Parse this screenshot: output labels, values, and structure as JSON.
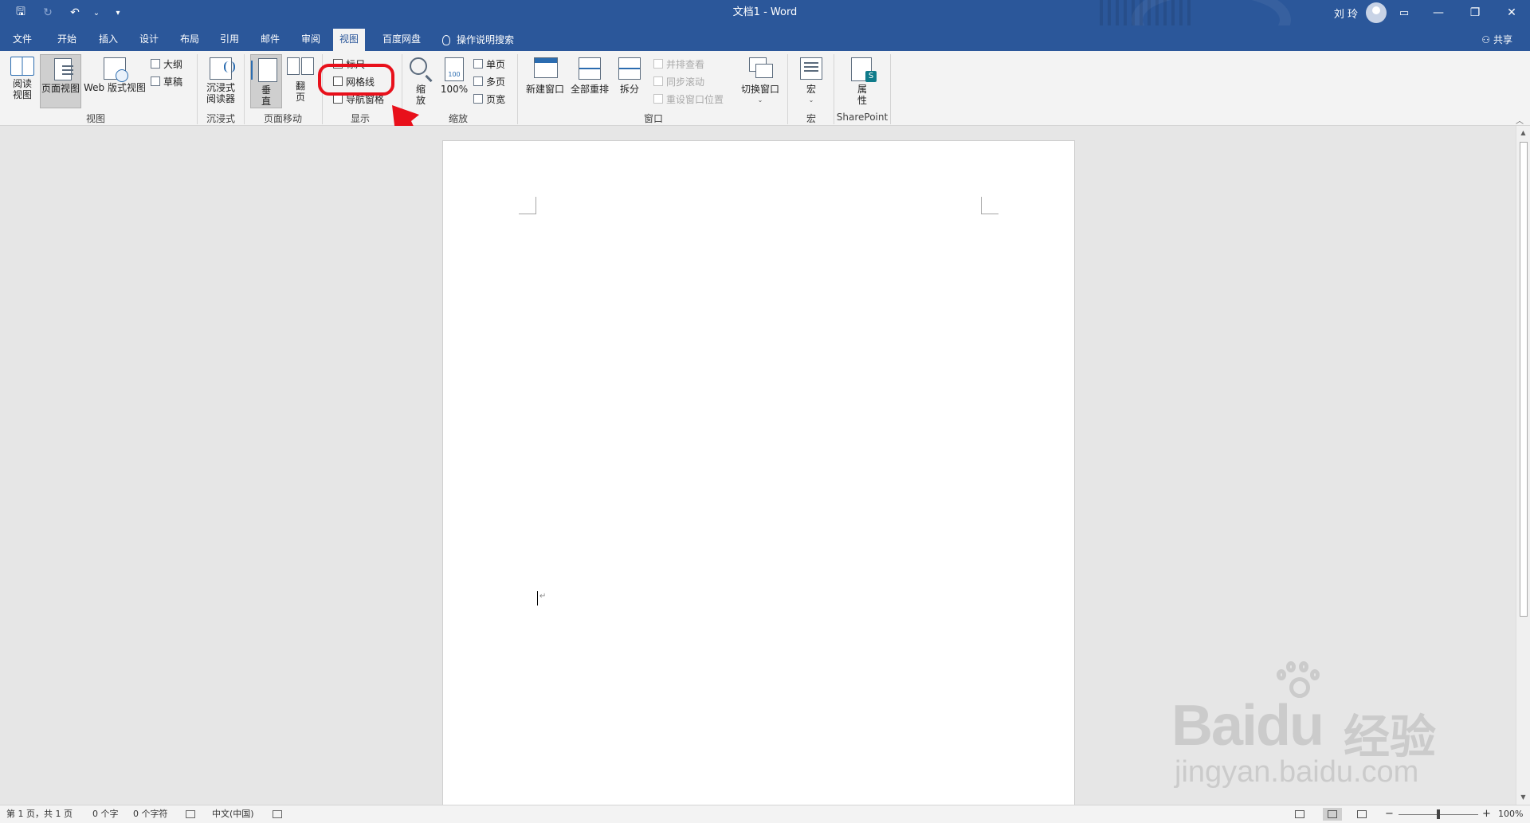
{
  "titlebar": {
    "title": "文档1  -  Word",
    "user_name": "刘 玲",
    "qat": {
      "save": "🖫",
      "redo": "↻",
      "undo": "↶",
      "undo_more": "⌄",
      "customize": "▾"
    },
    "ribbon_display": "▭",
    "minimize": "—",
    "restore": "❐",
    "close": "✕"
  },
  "tabs": [
    {
      "label": "文件"
    },
    {
      "label": "开始"
    },
    {
      "label": "插入"
    },
    {
      "label": "设计"
    },
    {
      "label": "布局"
    },
    {
      "label": "引用"
    },
    {
      "label": "邮件"
    },
    {
      "label": "审阅"
    },
    {
      "label": "视图"
    },
    {
      "label": "百度网盘"
    }
  ],
  "active_tab": "视图",
  "tell_me": "操作说明搜索",
  "share": "共享",
  "ribbon": {
    "views": {
      "label": "视图",
      "read_mode": "阅读\n视图",
      "print_layout": "页面视图",
      "web_layout": "Web 版式视图",
      "outline": "大纲",
      "draft": "草稿"
    },
    "immersive": {
      "label": "沉浸式",
      "reader": "沉浸式\n阅读器"
    },
    "page_movement": {
      "label": "页面移动",
      "vertical": "垂\n直",
      "side_to_side": "翻\n页"
    },
    "show": {
      "label": "显示",
      "ruler": "标尺",
      "gridlines": "网格线",
      "nav_pane": "导航窗格"
    },
    "zoom": {
      "label": "缩放",
      "zoom": "缩\n放",
      "hundred": "100%",
      "one_page": "单页",
      "multi_page": "多页",
      "page_width": "页宽",
      "icon_text": "100"
    },
    "window": {
      "label": "窗口",
      "new_window": "新建窗口",
      "arrange_all": "全部重排",
      "split": "拆分",
      "side_by_side": "并排查看",
      "sync_scroll": "同步滚动",
      "reset_position": "重设窗口位置",
      "switch_windows": "切换窗口"
    },
    "macros": {
      "label": "宏",
      "macros": "宏"
    },
    "sharepoint": {
      "label": "SharePoint",
      "properties": "属\n性"
    }
  },
  "document": {
    "para_mark": "↵"
  },
  "watermark": {
    "brand": "Bai",
    "brand2": "du",
    "cn": "经验",
    "url": "jingyan.baidu.com"
  },
  "status": {
    "page": "第 1 页，共 1 页",
    "words": "0 个字",
    "chars": "0 个字符",
    "language": "中文(中国)",
    "zoom_minus": "−",
    "zoom_plus": "+",
    "zoom": "100%",
    "zoom_level_percent": 100
  },
  "colors": {
    "accent": "#2b579a",
    "highlight": "#e8101b"
  }
}
